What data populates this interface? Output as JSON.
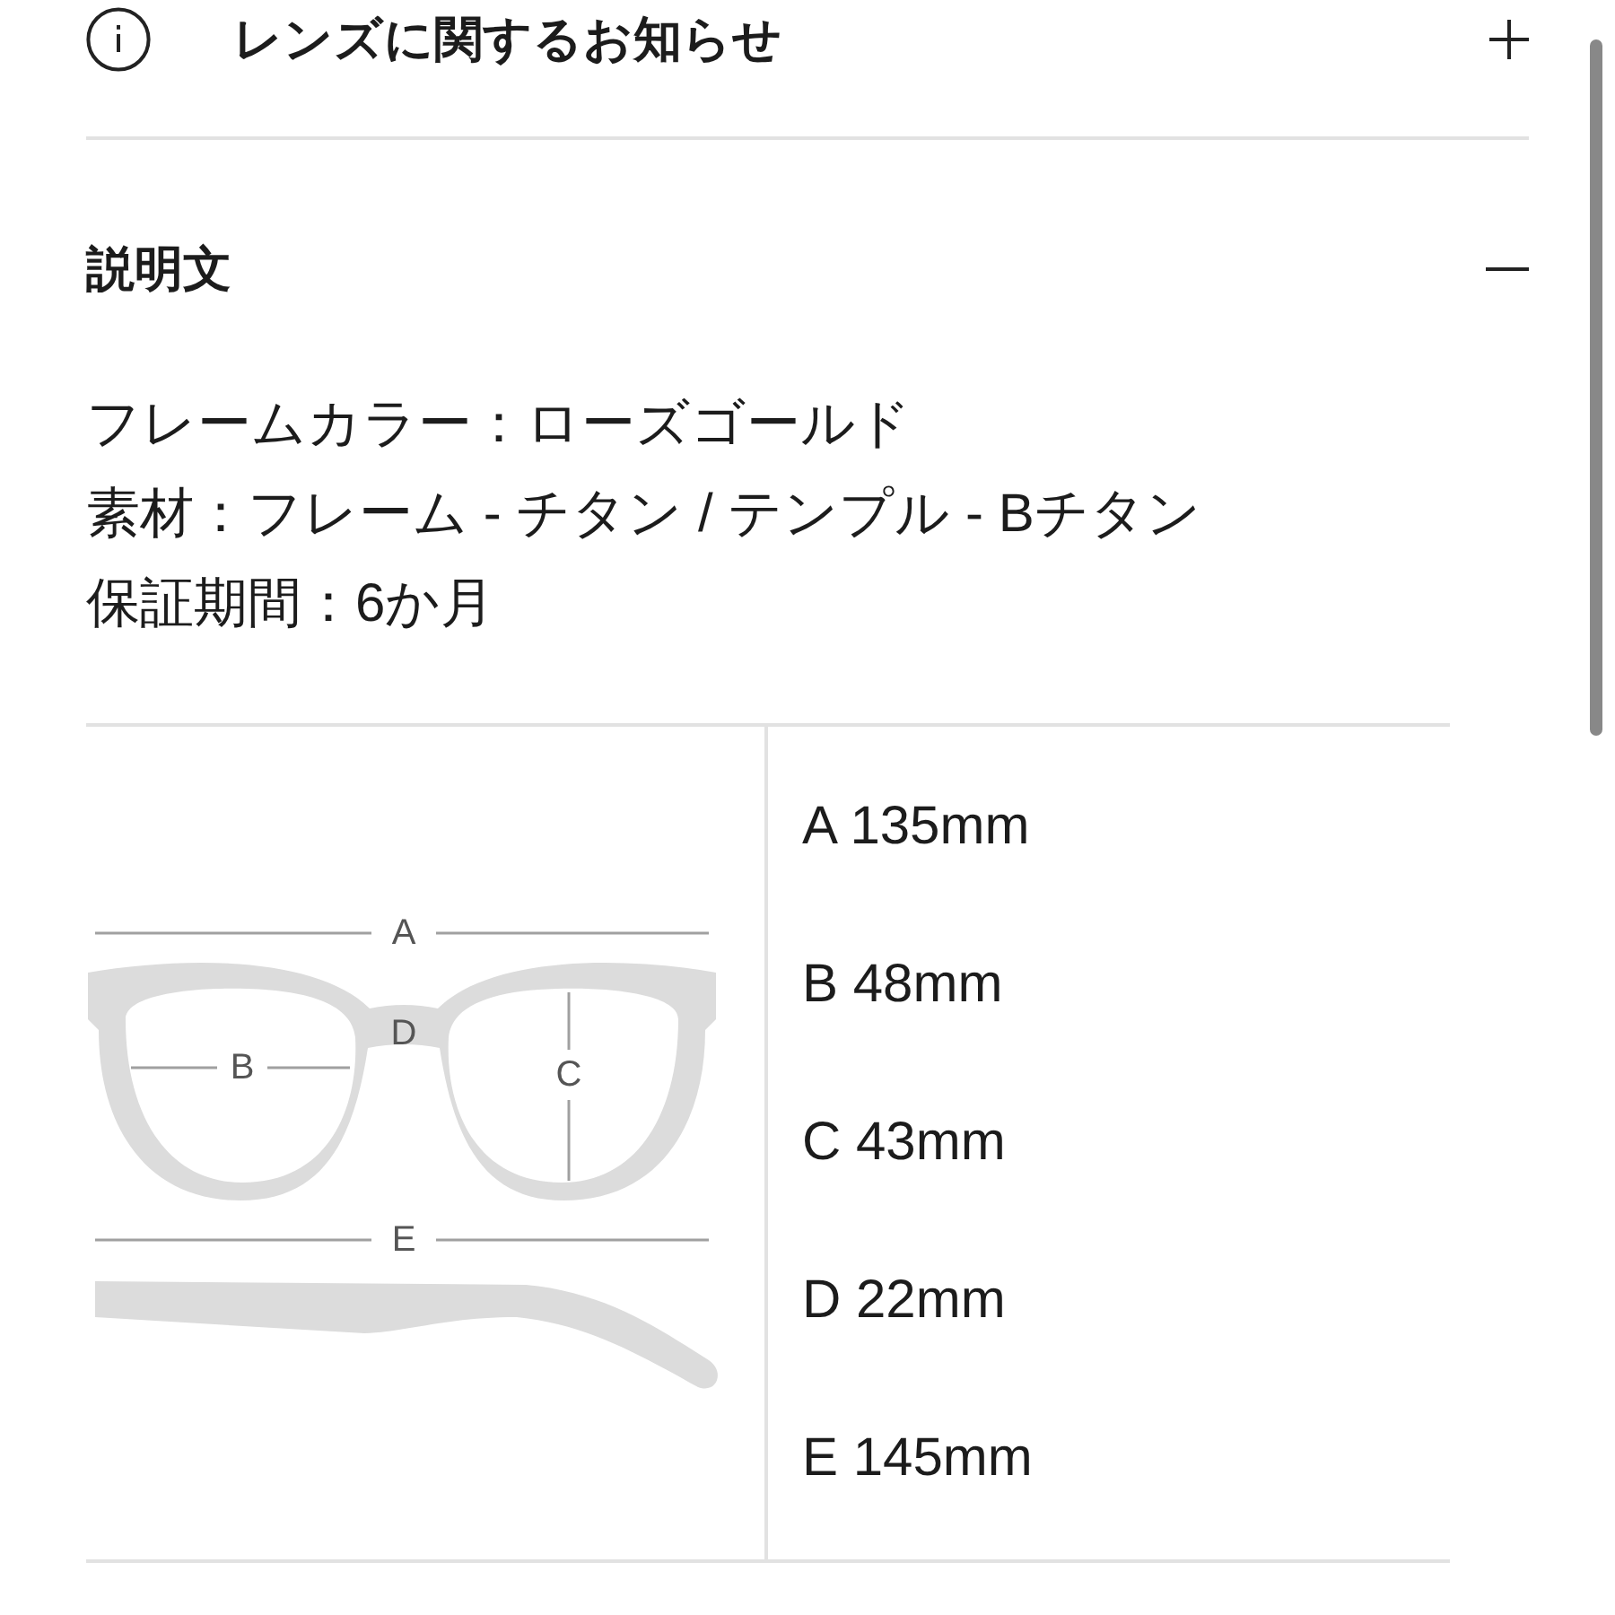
{
  "sections": [
    {
      "kind": "notice",
      "title": "レンズに関するお知らせ",
      "expanded": false
    },
    {
      "kind": "description",
      "title": "説明文",
      "expanded": true,
      "lines": [
        "フレームカラー：ローズゴールド",
        "素材：フレーム - チタン / テンプル - Bチタン",
        "保証期間：6か月"
      ],
      "size_chart": {
        "diagram_labels": [
          "A",
          "B",
          "C",
          "D",
          "E"
        ],
        "measurements": [
          "A 135mm",
          "B 48mm",
          "C 43mm",
          "D 22mm",
          "E 145mm"
        ]
      }
    }
  ]
}
